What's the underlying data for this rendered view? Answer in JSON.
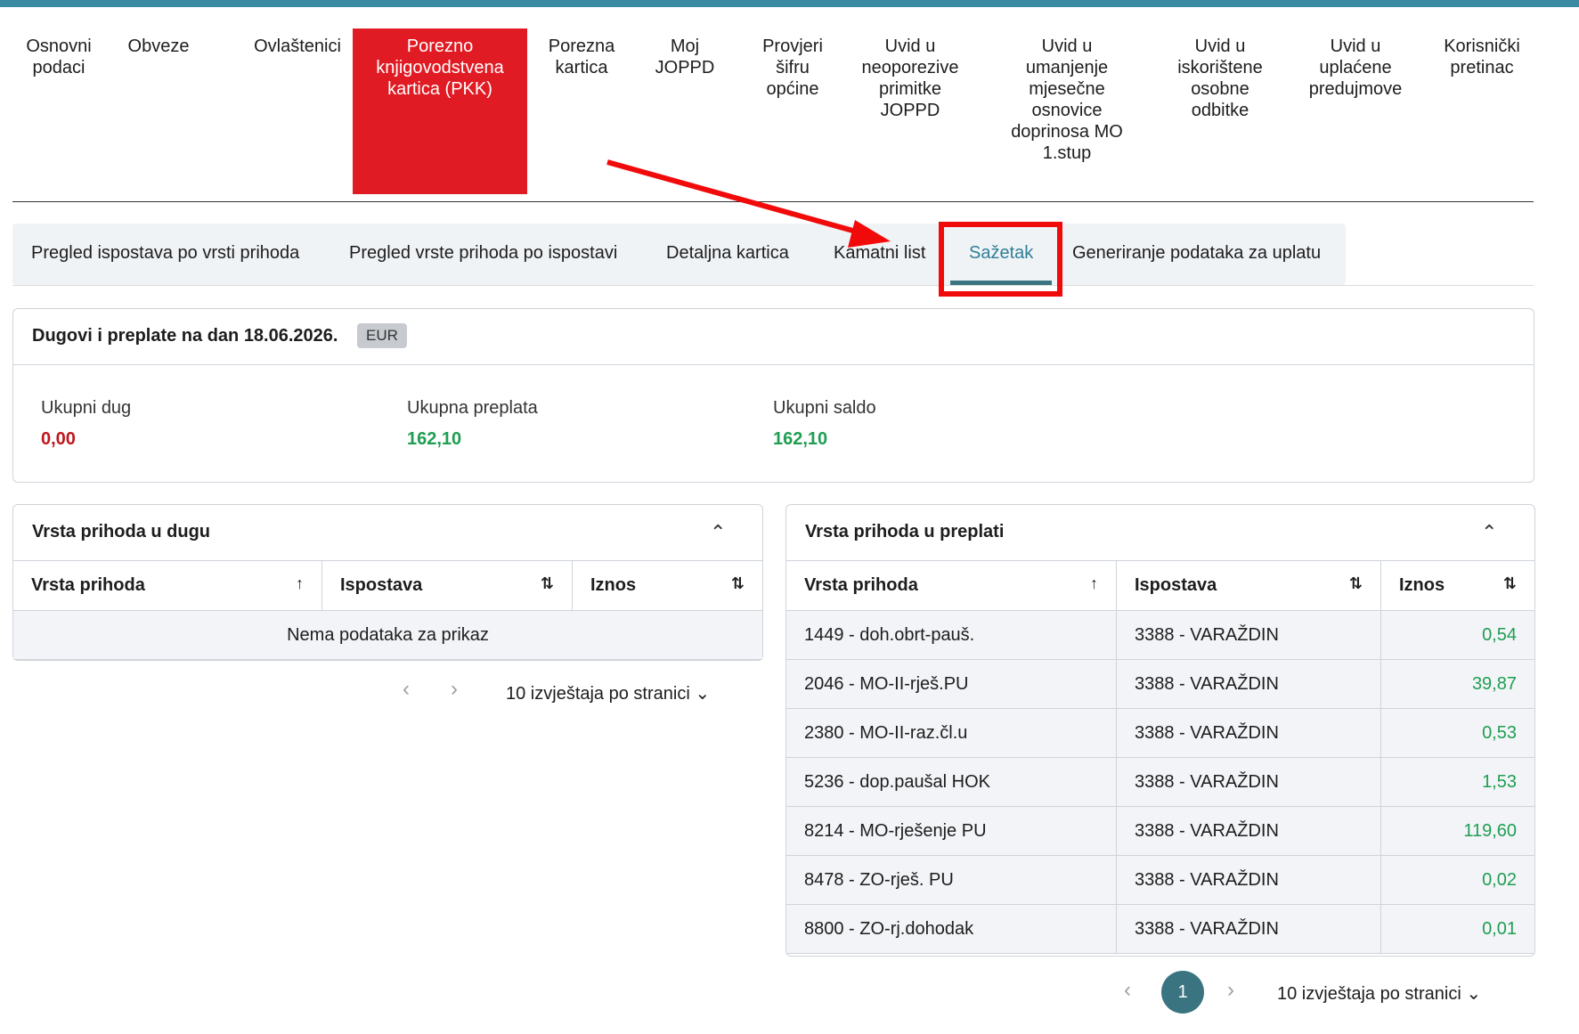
{
  "top_nav": [
    {
      "label": "Osnovni\npodaci"
    },
    {
      "label": "Obveze"
    },
    {
      "label": "Ovlaštenici"
    },
    {
      "label": "Porezno\nknjigovodstvena\nkartica (PKK)"
    },
    {
      "label": "Porezna\nkartica"
    },
    {
      "label": "Moj\nJOPPD"
    },
    {
      "label": "Provjeri\nšifru\nopćine"
    },
    {
      "label": "Uvid u\nneoporezive\nprimitke\nJOPPD"
    },
    {
      "label": "Uvid u\numanjenje\nmjesečne\nosnovice\ndoprinosa MO\n1.stup"
    },
    {
      "label": "Uvid u\niskorištene\nosobne\nodbitke"
    },
    {
      "label": "Uvid u\nuplaćene\npredujmove"
    },
    {
      "label": "Korisnički\npretinac"
    }
  ],
  "subtabs": [
    {
      "label": "Pregled ispostava po vrsti prihoda"
    },
    {
      "label": "Pregled vrste prihoda po ispostavi"
    },
    {
      "label": "Detaljna kartica"
    },
    {
      "label": "Kamatni list"
    },
    {
      "label": "Sažetak"
    },
    {
      "label": "Generiranje podataka za uplatu"
    }
  ],
  "summary": {
    "title": "Dugovi i preplate na dan 18.06.2026.",
    "currency": "EUR",
    "debt_label": "Ukupni dug",
    "debt_value": "0,00",
    "overpay_label": "Ukupna preplata",
    "overpay_value": "162,10",
    "saldo_label": "Ukupni saldo",
    "saldo_value": "162,10"
  },
  "debt_table": {
    "title": "Vrsta prihoda u dugu",
    "columns": [
      "Vrsta prihoda",
      "Ispostava",
      "Iznos"
    ],
    "empty_text": "Nema podataka za prikaz",
    "per_page": "10 izvještaja po stranici"
  },
  "overpay_table": {
    "title": "Vrsta prihoda u preplati",
    "columns": [
      "Vrsta prihoda",
      "Ispostava",
      "Iznos"
    ],
    "rows": [
      [
        "1449 - doh.obrt-pauš.",
        "3388 - VARAŽDIN",
        "0,54"
      ],
      [
        "2046 - MO-II-rješ.PU",
        "3388 - VARAŽDIN",
        "39,87"
      ],
      [
        "2380 - MO-II-raz.čl.u",
        "3388 - VARAŽDIN",
        "0,53"
      ],
      [
        "5236 - dop.paušal HOK",
        "3388 - VARAŽDIN",
        "1,53"
      ],
      [
        "8214 - MO-rješenje PU",
        "3388 - VARAŽDIN",
        "119,60"
      ],
      [
        "8478 - ZO-rješ. PU",
        "3388 - VARAŽDIN",
        "0,02"
      ],
      [
        "8800 - ZO-rj.dohodak",
        "3388 - VARAŽDIN",
        "0,01"
      ]
    ],
    "page": "1",
    "per_page": "10 izvještaja po stranici"
  },
  "icons": {
    "chevron_up": "chevron-up-icon",
    "chevron_down": "chevron-down-icon",
    "sort_asc": "sort-ascending-icon",
    "sort_both": "sort-both-icon",
    "prev": "chevron-left-icon",
    "next": "chevron-right-icon"
  },
  "colors": {
    "accent": "#3a8aa3",
    "active_tab_bg": "#e01b24",
    "debt": "#c0161d",
    "overpay": "#1f9e52",
    "annotation": "#f10a0a"
  }
}
